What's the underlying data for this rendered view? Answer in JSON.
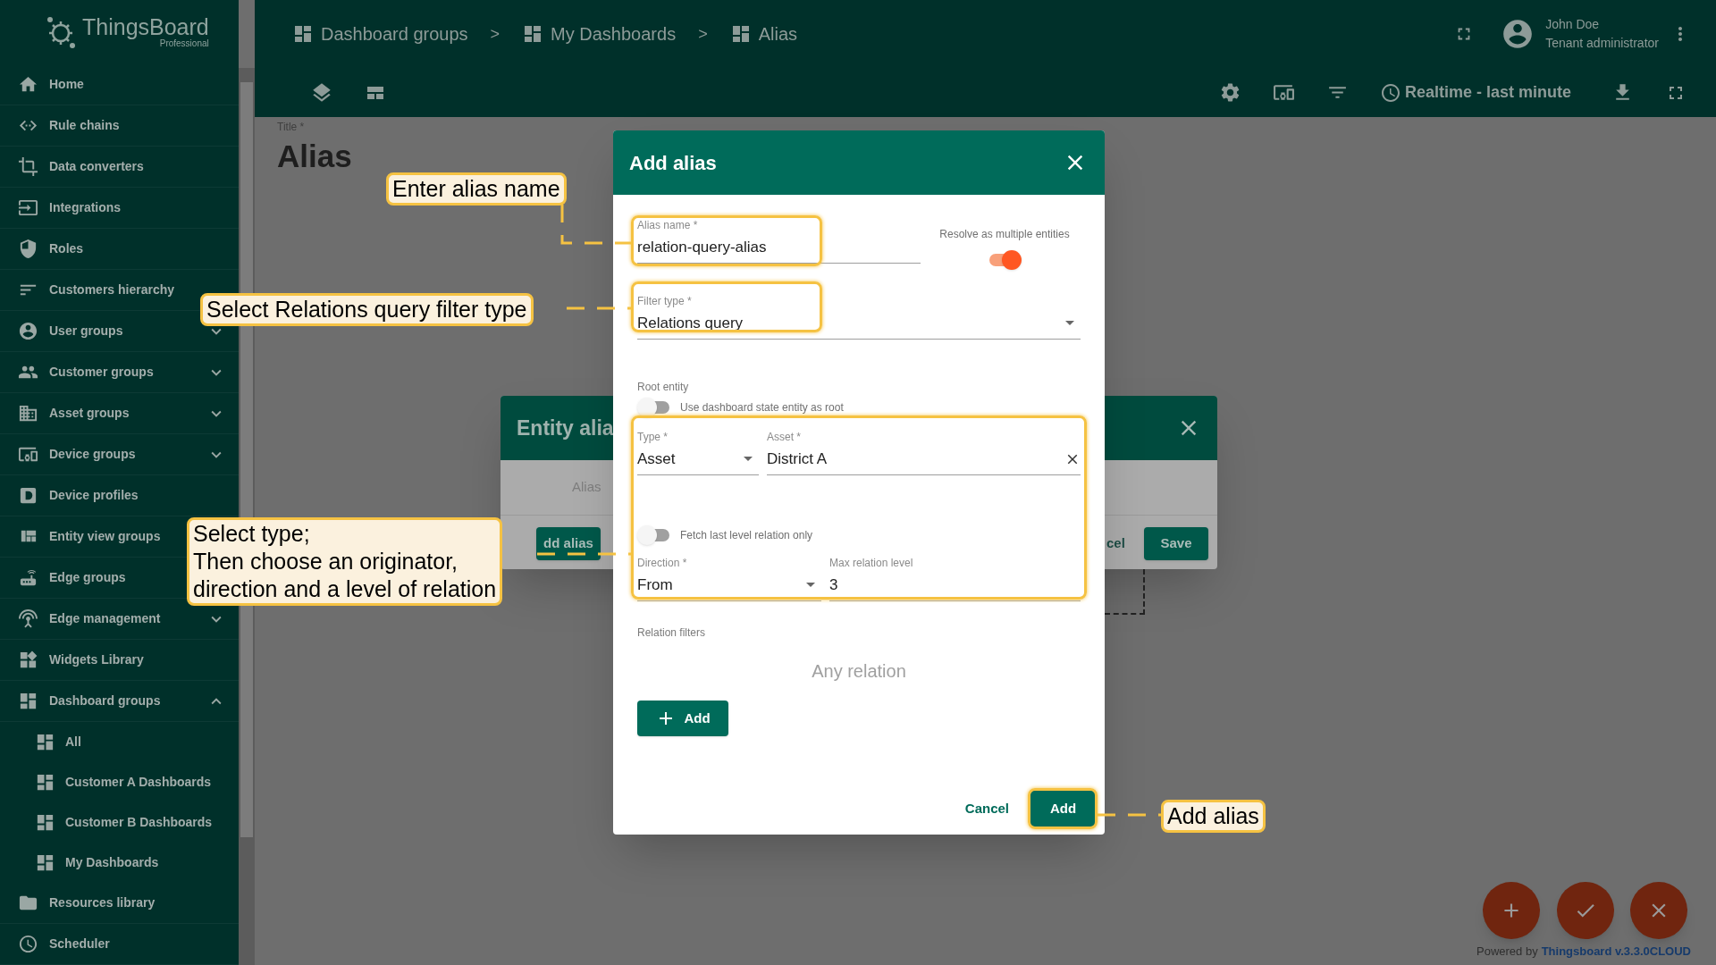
{
  "sidebar": {
    "logo": {
      "name": "ThingsBoard",
      "edition": "Professional"
    },
    "items": [
      {
        "label": "Home"
      },
      {
        "label": "Rule chains"
      },
      {
        "label": "Data converters"
      },
      {
        "label": "Integrations"
      },
      {
        "label": "Roles"
      },
      {
        "label": "Customers hierarchy"
      },
      {
        "label": "User groups",
        "expanded": false
      },
      {
        "label": "Customer groups",
        "expanded": false
      },
      {
        "label": "Asset groups",
        "expanded": false
      },
      {
        "label": "Device groups",
        "expanded": false
      },
      {
        "label": "Device profiles"
      },
      {
        "label": "Entity view groups"
      },
      {
        "label": "Edge groups"
      },
      {
        "label": "Edge management",
        "expanded": false
      },
      {
        "label": "Widgets Library"
      },
      {
        "label": "Dashboard groups",
        "expanded": true,
        "children": [
          {
            "label": "All"
          },
          {
            "label": "Customer A Dashboards"
          },
          {
            "label": "Customer B Dashboards"
          },
          {
            "label": "My Dashboards"
          }
        ]
      },
      {
        "label": "Resources library"
      },
      {
        "label": "Scheduler"
      }
    ]
  },
  "header": {
    "breadcrumbs": [
      "Dashboard groups",
      "My Dashboards",
      "Alias"
    ],
    "separators": [
      ">",
      ">"
    ],
    "user": {
      "name": "John Doe",
      "role": "Tenant administrator"
    },
    "timewindow": "Realtime - last minute"
  },
  "dashboard": {
    "title_label": "Title *",
    "title": "Alias"
  },
  "entity_aliases_dialog": {
    "title": "Entity alia",
    "column_1": "Alias",
    "buttons": [
      {
        "label": "dd alias",
        "kind": "primary"
      },
      {
        "label": "cel",
        "kind": "text"
      },
      {
        "label": "Save",
        "kind": "primary"
      }
    ]
  },
  "add_alias_dialog": {
    "title": "Add alias",
    "alias_name": {
      "label": "Alias name *",
      "value": "relation-query-alias"
    },
    "resolve_multiple": {
      "label": "Resolve as multiple entities",
      "on": true
    },
    "filter_type": {
      "label": "Filter type *",
      "value": "Relations query"
    },
    "root_entity": {
      "label": "Root entity",
      "use_state": {
        "label": "Use dashboard state entity as root",
        "on": false
      }
    },
    "type": {
      "label": "Type *",
      "value": "Asset"
    },
    "asset": {
      "label": "Asset *",
      "value": "District A"
    },
    "fetch_last_level": {
      "label": "Fetch last level relation only",
      "on": false
    },
    "direction": {
      "label": "Direction *",
      "value": "From"
    },
    "max_level": {
      "label": "Max relation level",
      "value": "3"
    },
    "relation_filters": {
      "label": "Relation filters",
      "empty_text": "Any relation",
      "add_button": "Add"
    },
    "buttons": [
      {
        "label": "Cancel",
        "kind": "text"
      },
      {
        "label": "Add",
        "kind": "primary"
      }
    ]
  },
  "callouts": [
    {
      "text": "Enter alias name"
    },
    {
      "text": "Select Relations query filter type"
    },
    {
      "text": "Select type;\nThen choose an originator,\ndirection and a level of relation"
    },
    {
      "text": "Add alias"
    }
  ],
  "footer": {
    "powered_by": "Powered by",
    "version_link": "Thingsboard v.3.3.0CLOUD"
  }
}
